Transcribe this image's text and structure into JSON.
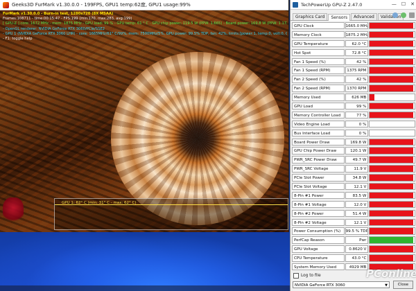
{
  "furmark": {
    "window_title": "Geeks3D FurMark v1.30.0.0 - 199FPS, GPU1 temp:62度, GPU1 usage:99%",
    "overlay": [
      {
        "text": "FurMark v1.30.0.0 - Burn-in test, 1280x720 (8X MSAA)",
        "color": "yellow"
      },
      {
        "text": "Frames:108711 - time:00:15:47 - FPS:199 (min:170, max:283, avg:199)",
        "color": "white"
      },
      {
        "text": "[ GPU-Z ] core: 1672 MHz - mem: 1875 MHz - GPU load: 99 % - GPU temp: 61 ° C - GPU chip power: 119.5 W (PPW: 1.665) - Board power: 169.8 W (PPW: 1.172) - GPU volt",
        "color": "green"
      },
      {
        "text": "- OpenGL renderer: NVIDIA GeForce RTX 3060/PCIe/SSE2",
        "color": "cyan"
      },
      {
        "text": "- GPU 1 (NVIDIA GeForce RTX 3060 LHR) - core: 1665MHz/61° C/99%, mem: 7500MHz/5%, GPU power: 99.5% TDP, fan: 42%, limits:[power:1, temp:0, volt:0, OV:0]",
        "color": "cyan"
      },
      {
        "text": "- F1: toggle help",
        "color": "white"
      }
    ],
    "graph_label": "GPU 1: 62° C (min: 31° C - max: 62° C)"
  },
  "gpuz": {
    "window_title": "TechPowerUp GPU-Z 2.47.0",
    "window_buttons": [
      "—",
      "☐",
      "✕"
    ],
    "tabs": [
      {
        "label": "Graphics Card",
        "active": false
      },
      {
        "label": "Sensors",
        "active": true
      },
      {
        "label": "Advanced",
        "active": false
      },
      {
        "label": "Validation",
        "active": false
      }
    ],
    "tab_icons": [
      "camera-icon",
      "refresh-icon",
      "menu-icon"
    ],
    "sensors": [
      {
        "name": "GPU Clock",
        "value": "1665.0 MHz",
        "bar": 0.97,
        "bar_color": "#e8141b"
      },
      {
        "name": "Memory Clock",
        "value": "1875.2 MHz",
        "bar": 0.97,
        "bar_color": "#e8141b"
      },
      {
        "name": "GPU Temperature",
        "value": "62.0 °C",
        "bar": 0.97,
        "bar_color": "#e8141b"
      },
      {
        "name": "Hot Spot",
        "value": "72.8 °C",
        "bar": 0.97,
        "bar_color": "#e8141b"
      },
      {
        "name": "Fan 1 Speed (%)",
        "value": "42 %",
        "bar": 0.97,
        "bar_color": "#e8141b"
      },
      {
        "name": "Fan 1 Speed (RPM)",
        "value": "1375 RPM",
        "bar": 0.97,
        "bar_color": "#e8141b"
      },
      {
        "name": "Fan 2 Speed (%)",
        "value": "42 %",
        "bar": 0.97,
        "bar_color": "#e8141b"
      },
      {
        "name": "Fan 2 Speed (RPM)",
        "value": "1370 RPM",
        "bar": 0.97,
        "bar_color": "#e8141b"
      },
      {
        "name": "Memory Used",
        "value": "626 MB",
        "bar": 0.1,
        "bar_color": "#e8141b"
      },
      {
        "name": "GPU Load",
        "value": "99 %",
        "bar": 0.97,
        "bar_color": "#e8141b"
      },
      {
        "name": "Memory Controller Load",
        "value": "77 %",
        "bar": 0.97,
        "bar_color": "#e8141b"
      },
      {
        "name": "Video Engine Load",
        "value": "0 %",
        "bar": 0,
        "bar_color": "#e8141b"
      },
      {
        "name": "Bus Interface Load",
        "value": "0 %",
        "bar": 0,
        "bar_color": "#e8141b"
      },
      {
        "name": "Board Power Draw",
        "value": "169.8 W",
        "bar": 0.97,
        "bar_color": "#e8141b"
      },
      {
        "name": "GPU Chip Power Draw",
        "value": "120.1 W",
        "bar": 0.97,
        "bar_color": "#e8141b"
      },
      {
        "name": "PWR_SRC Power Draw",
        "value": "49.7 W",
        "bar": 0.97,
        "bar_color": "#e8141b"
      },
      {
        "name": "PWR_SRC Voltage",
        "value": "11.9 V",
        "bar": 0.97,
        "bar_color": "#e8141b"
      },
      {
        "name": "PCIe Slot Power",
        "value": "34.8 W",
        "bar": 0.97,
        "bar_color": "#e8141b"
      },
      {
        "name": "PCIe Slot Voltage",
        "value": "12.1 V",
        "bar": 0.97,
        "bar_color": "#e8141b"
      },
      {
        "name": "8-Pin #1 Power",
        "value": "83.5 W",
        "bar": 0.97,
        "bar_color": "#e8141b"
      },
      {
        "name": "8-Pin #1 Voltage",
        "value": "12.0 V",
        "bar": 0.97,
        "bar_color": "#e8141b"
      },
      {
        "name": "8-Pin #2 Power",
        "value": "51.4 W",
        "bar": 0.97,
        "bar_color": "#e8141b"
      },
      {
        "name": "8-Pin #2 Voltage",
        "value": "12.1 V",
        "bar": 0.97,
        "bar_color": "#e8141b"
      },
      {
        "name": "Power Consumption (%)",
        "value": "99.5 % TDP",
        "bar": 0.97,
        "bar_color": "#e8141b"
      },
      {
        "name": "PerfCap Reason",
        "value": "Pwr",
        "bar": 0.97,
        "bar_color": "#2fb52f"
      },
      {
        "name": "GPU Voltage",
        "value": "0.8620 V",
        "bar": 0.97,
        "bar_color": "#e8141b"
      },
      {
        "name": "CPU Temperature",
        "value": "43.0 °C",
        "bar": 0.97,
        "bar_color": "#e8141b"
      },
      {
        "name": "System Memory Used",
        "value": "4929 MB",
        "bar": 0.97,
        "bar_color": "#e8141b"
      }
    ],
    "log_label": "Log to file",
    "gpu_select": "NVIDIA GeForce RTX 3060",
    "close_label": "Close"
  },
  "watermark": "PConline",
  "colors": {
    "red_bar": "#e8141b",
    "green_bar": "#2fb52f",
    "overlay_yellow": "#ffe600",
    "overlay_green": "#57e34b",
    "overlay_cyan": "#35d3f2"
  }
}
